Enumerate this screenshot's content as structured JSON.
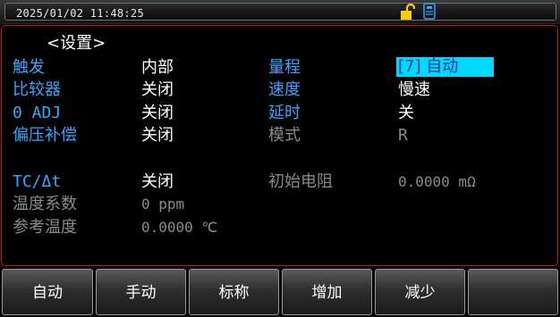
{
  "statusbar": {
    "datetime": "2025/01/02  11:48:25",
    "icons": [
      "unlock-icon",
      "usb-icon"
    ],
    "icon_color": "#ffcc00",
    "usb_color": "#2ea8ff"
  },
  "settings": {
    "title": "<设置>",
    "rows": [
      {
        "left_label": "触发",
        "left_value": "内部",
        "right_label": "量程",
        "right_value": "[7] 自动"
      },
      {
        "left_label": "比较器",
        "left_value": "关闭",
        "right_label": "速度",
        "right_value": "慢速"
      },
      {
        "left_label": "0 ADJ",
        "left_value": "关闭",
        "right_label": "延时",
        "right_value": "关"
      },
      {
        "left_label": "偏压补偿",
        "left_value": "关闭",
        "right_label": "模式",
        "right_value": "R"
      },
      {
        "left_label": "TC/Δt",
        "left_value": "关闭",
        "right_label": "初始电阻",
        "right_value": "0.0000 mΩ"
      },
      {
        "left_label": "温度系数",
        "left_value": "0 ppm"
      },
      {
        "left_label": "参考温度",
        "left_value": "0.0000 ℃"
      }
    ]
  },
  "softkeys": [
    "自动",
    "手动",
    "标称",
    "增加",
    "减少",
    ""
  ],
  "colors": {
    "label_active": "#2ea8ff",
    "label_disabled": "#8a8a8a",
    "value": "#ffffff",
    "selected_bg": "#00d8ff",
    "panel_border": "#cc1010"
  }
}
